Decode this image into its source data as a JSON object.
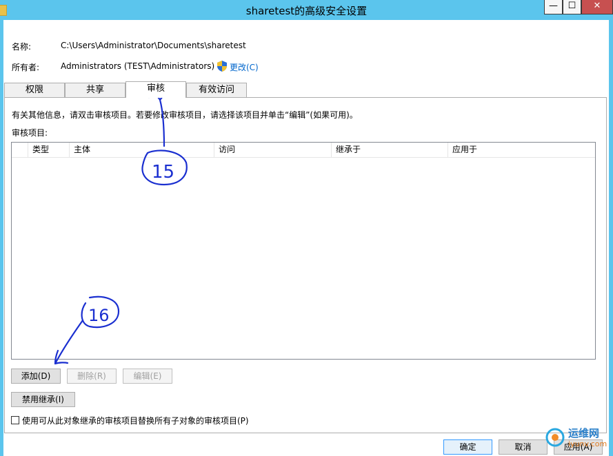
{
  "window": {
    "title": "sharetest的高级安全设置",
    "min_glyph": "—",
    "max_glyph": "☐",
    "close_glyph": "✕"
  },
  "info": {
    "name_label": "名称:",
    "name_value": "C:\\Users\\Administrator\\Documents\\sharetest",
    "owner_label": "所有者:",
    "owner_value": "Administrators (TEST\\Administrators)",
    "change_link": "更改(C)"
  },
  "tabs": [
    "权限",
    "共享",
    "审核",
    "有效访问"
  ],
  "active_tab": "审核",
  "panel": {
    "description": "有关其他信息，请双击审核项目。若要修改审核项目，请选择该项目并单击“编辑”(如果可用)。",
    "list_label": "审核项目:",
    "columns": [
      "类型",
      "主体",
      "访问",
      "继承于",
      "应用于"
    ]
  },
  "buttons": {
    "add": "添加(D)",
    "remove": "删除(R)",
    "edit": "编辑(E)",
    "disable_inheritance": "禁用继承(I)"
  },
  "checkbox": {
    "label": "使用可从此对象继承的审核项目替换所有子对象的审核项目(P)",
    "checked": false
  },
  "footer": {
    "ok": "确定",
    "cancel": "取消",
    "apply": "应用(A)"
  },
  "annotations": [
    "15",
    "16"
  ],
  "watermark": {
    "text": "运维网",
    "subtext": "iyunv.com"
  }
}
